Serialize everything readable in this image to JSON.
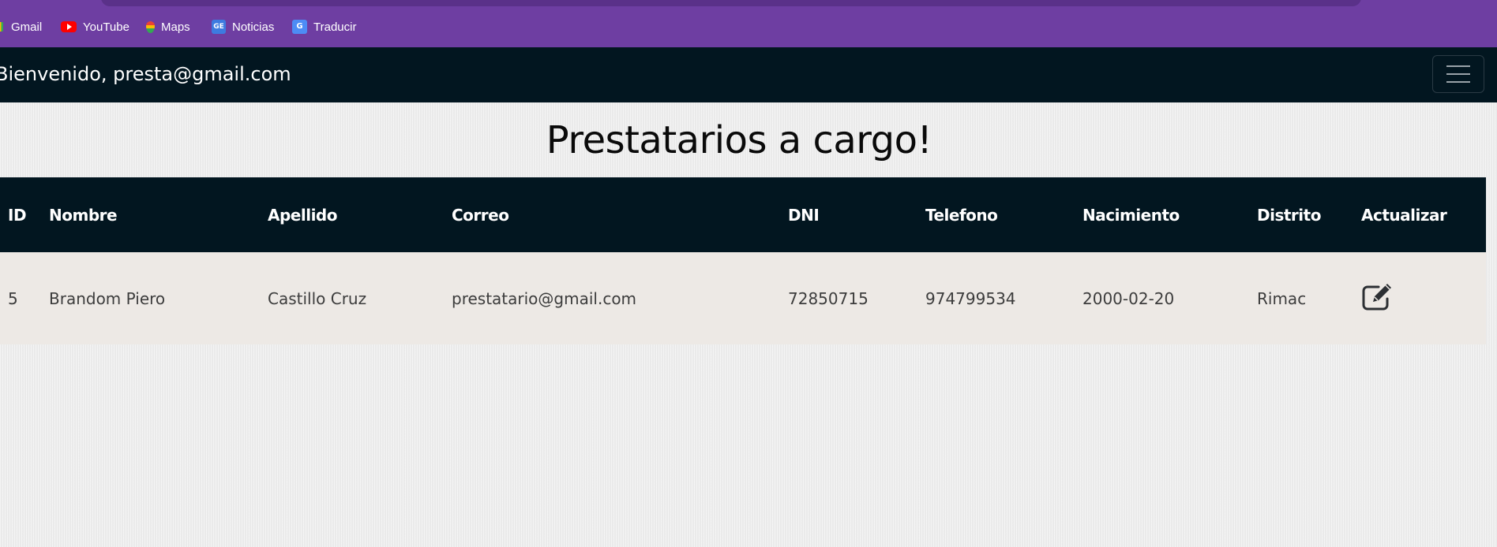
{
  "browser": {
    "bookmarks": [
      {
        "label": "Gmail",
        "icon": "gmail-icon"
      },
      {
        "label": "YouTube",
        "icon": "youtube-icon"
      },
      {
        "label": "Maps",
        "icon": "maps-icon"
      },
      {
        "label": "Noticias",
        "icon": "news-icon"
      },
      {
        "label": "Traducir",
        "icon": "translate-icon"
      }
    ],
    "colors": {
      "bar": "#6e3ea2"
    }
  },
  "navbar": {
    "welcome": "Bienvenido, presta@gmail.com",
    "toggle_icon": "hamburger-icon",
    "background": "#021620"
  },
  "page": {
    "title": "Prestatarios a cargo!"
  },
  "table": {
    "headers": [
      "ID",
      "Nombre",
      "Apellido",
      "Correo",
      "DNI",
      "Telefono",
      "Nacimiento",
      "Distrito",
      "Actualizar"
    ],
    "rows": [
      {
        "id": "5",
        "nombre": "Brandom Piero",
        "apellido": "Castillo Cruz",
        "correo": "prestatario@gmail.com",
        "dni": "72850715",
        "telefono": "974799534",
        "nacimiento": "2000-02-20",
        "distrito": "Rimac",
        "action_icon": "edit-icon"
      }
    ]
  }
}
